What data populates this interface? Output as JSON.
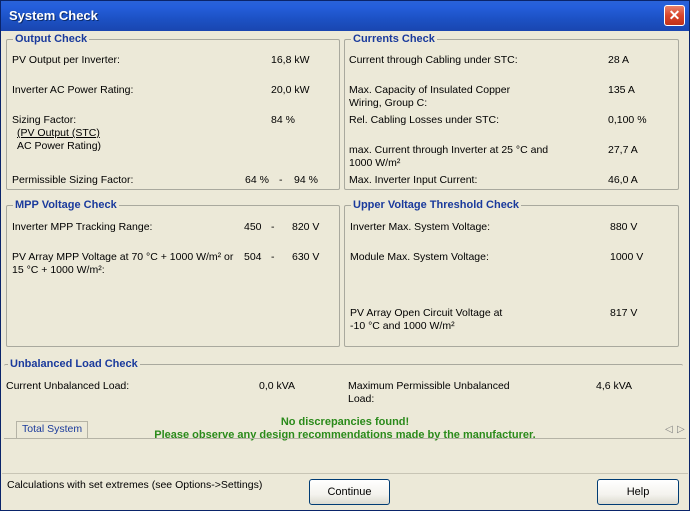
{
  "window": {
    "title": "System Check",
    "close_glyph": "✕"
  },
  "output_check": {
    "title": "Output Check",
    "pv_output_label": "PV Output per Inverter:",
    "pv_output_value": "16,8 kW",
    "inverter_ac_label": "Inverter AC Power Rating:",
    "inverter_ac_value": "20,0 kW",
    "sizing_factor_label": "Sizing Factor:",
    "sizing_factor_num": "(PV Output (STC)",
    "sizing_factor_den": "AC Power Rating)",
    "sizing_factor_value": "84 %",
    "permissible_label": "Permissible Sizing Factor:",
    "permissible_min": "64 %",
    "permissible_dash": "-",
    "permissible_max": "94 %"
  },
  "currents_check": {
    "title": "Currents Check",
    "cabling_label": "Current through Cabling under STC:",
    "cabling_value": "28 A",
    "max_capacity_label_1": "Max. Capacity of Insulated Copper",
    "max_capacity_label_2": "Wiring, Group C:",
    "max_capacity_value": "135 A",
    "losses_label": "Rel. Cabling Losses under STC:",
    "losses_value": "0,100 %",
    "max_current_label_1": "max. Current through Inverter at 25 °C and",
    "max_current_label_2": "1000 W/m²",
    "max_current_value": "27,7 A",
    "max_input_label": "Max. Inverter Input Current:",
    "max_input_value": "46,0 A"
  },
  "mpp_check": {
    "title": "MPP Voltage Check",
    "tracking_label": "Inverter MPP Tracking Range:",
    "tracking_min": "450",
    "tracking_dash": "-",
    "tracking_max": "820 V",
    "array_label_1": "PV Array MPP Voltage at 70 °C + 1000 W/m² or",
    "array_label_2": "15 °C + 1000 W/m²:",
    "array_min": "504",
    "array_dash": "-",
    "array_max": "630 V"
  },
  "upper_check": {
    "title": "Upper Voltage Threshold Check",
    "inv_max_label": "Inverter Max. System Voltage:",
    "inv_max_value": "880 V",
    "mod_max_label": "Module Max. System Voltage:",
    "mod_max_value": "1000 V",
    "open_circuit_label_1": "PV Array Open Circuit Voltage at",
    "open_circuit_label_2": "-10 °C and 1000 W/m²",
    "open_circuit_value": "817 V"
  },
  "unbalanced_check": {
    "title": "Unbalanced Load Check",
    "current_label": "Current Unbalanced Load:",
    "current_value": "0,0 kVA",
    "max_label_1": "Maximum Permissible Unbalanced",
    "max_label_2": "Load:",
    "max_value": "4,6 kVA"
  },
  "messages": {
    "line1": "No discrepancies found!",
    "line2": "Please observe any design recommendations made by the manufacturer."
  },
  "tabs": {
    "total_system": "Total System"
  },
  "status": {
    "text": "Calculations with set extremes (see Options->Settings)",
    "continue": "Continue",
    "help": "Help"
  }
}
